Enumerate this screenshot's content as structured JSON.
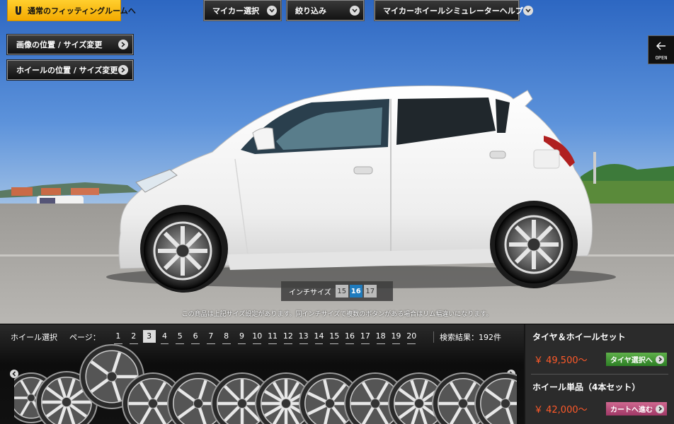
{
  "top": {
    "fitting_label": "通常のフィッティングルームへ",
    "my_car_label": "マイカー選択",
    "filter_label": "絞り込み",
    "help_label": "マイカーホイールシミュレーターヘルプ"
  },
  "side": {
    "image_label": "画像の位置 / サイズ変更",
    "wheel_label": "ホイールの位置 / サイズ変更"
  },
  "open": {
    "label": "OPEN"
  },
  "inch": {
    "label": "インチサイズ",
    "options": [
      "15",
      "16",
      "17"
    ],
    "selected": "16"
  },
  "note": "この商品は上記サイズ設定があります。同インチサイズで複数のボタンがある場合はリム幅違いになります。",
  "wheel_panel": {
    "title": "ホイール選択",
    "page_label": "ページ：",
    "pages": [
      "1",
      "2",
      "3",
      "4",
      "5",
      "6",
      "7",
      "8",
      "9",
      "10",
      "11",
      "12",
      "13",
      "14",
      "15",
      "16",
      "17",
      "18",
      "19",
      "20"
    ],
    "current_page": "3",
    "results": "検索結果：192件"
  },
  "set": {
    "title": "タイヤ＆ホイールセット",
    "price": "￥ 49,500〜",
    "button": "タイヤ選択へ"
  },
  "single": {
    "title": "ホイール単品（4本セット）",
    "price": "￥ 42,000〜",
    "button": "カートへ進む"
  },
  "colors": {
    "accent_yellow": "#f3a900",
    "price_red": "#ff5a2a",
    "active_inch": "#1f7bbd",
    "green_button": "#3e9432",
    "pink_button": "#b84a78"
  }
}
